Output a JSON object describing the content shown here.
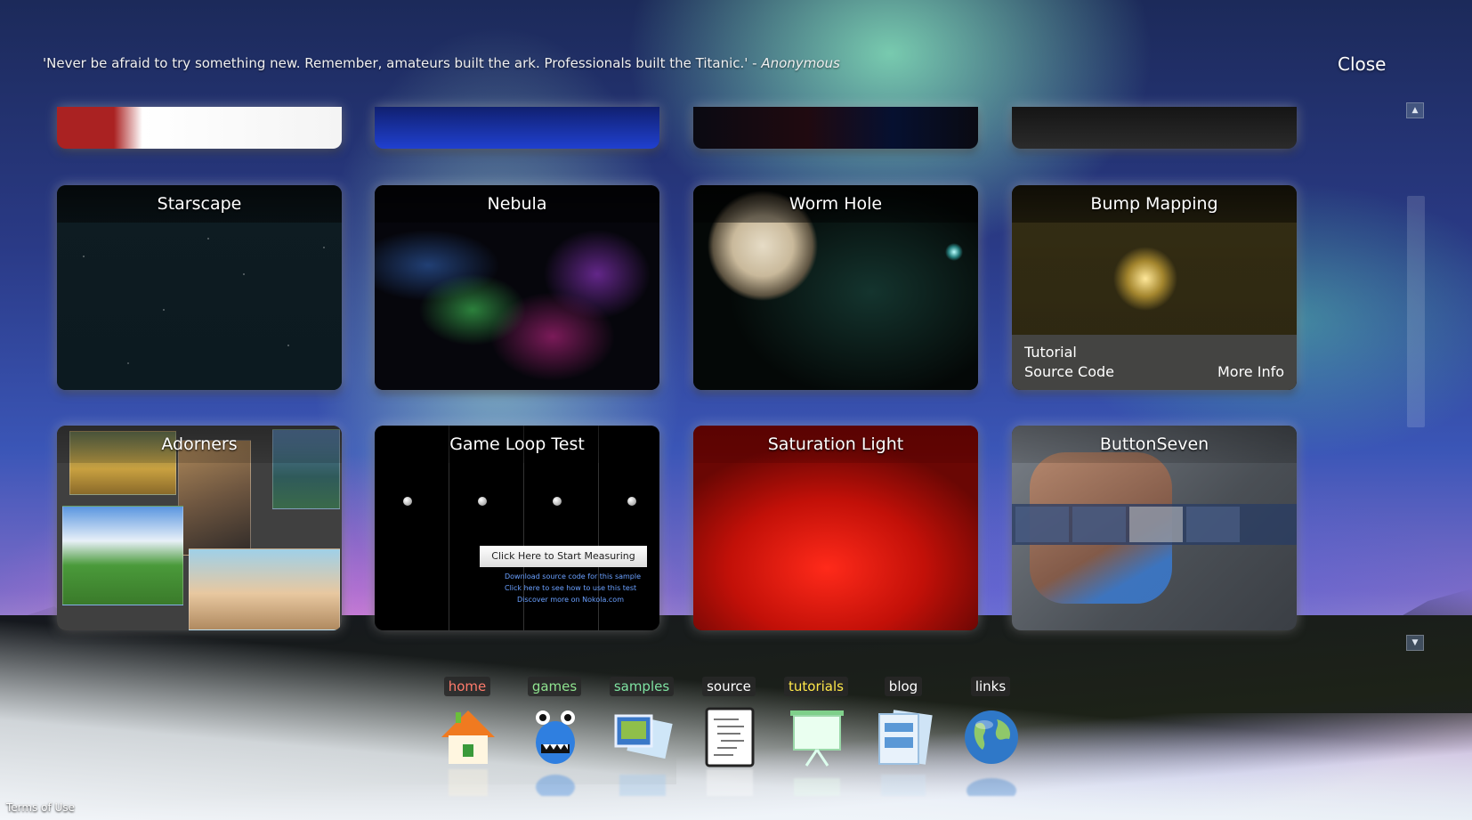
{
  "quote": {
    "text": "'Never be afraid to try something new. Remember, amateurs built the ark. Professionals built the Titanic.' - ",
    "author": "Anonymous"
  },
  "close_label": "Close",
  "tiles": [
    {
      "title": "Starscape"
    },
    {
      "title": "Nebula"
    },
    {
      "title": "Worm Hole"
    },
    {
      "title": "Bump Mapping",
      "links": {
        "tutorial": "Tutorial",
        "source": "Source Code",
        "more": "More Info"
      }
    },
    {
      "title": "Adorners"
    },
    {
      "title": "Game Loop Test",
      "button": "Click Here to Start Measuring",
      "links": [
        "Download source code for this sample",
        "Click here to see how to use this test",
        "Discover more on Nokola.com"
      ]
    },
    {
      "title": "Saturation Light"
    },
    {
      "title": "ButtonSeven"
    }
  ],
  "dock": [
    {
      "label": "home",
      "color": "#ff7b6b",
      "icon": "house-icon"
    },
    {
      "label": "games",
      "color": "#8fe38f",
      "icon": "monster-icon"
    },
    {
      "label": "samples",
      "color": "#7fe3a2",
      "icon": "photos-icon"
    },
    {
      "label": "source",
      "color": "#ffffff",
      "icon": "code-page-icon"
    },
    {
      "label": "tutorials",
      "color": "#ffe84a",
      "icon": "presentation-board-icon"
    },
    {
      "label": "blog",
      "color": "#ffffff",
      "icon": "documents-icon"
    },
    {
      "label": "links",
      "color": "#ffffff",
      "icon": "globe-icon"
    }
  ],
  "footer": {
    "terms": "Terms of Use"
  }
}
